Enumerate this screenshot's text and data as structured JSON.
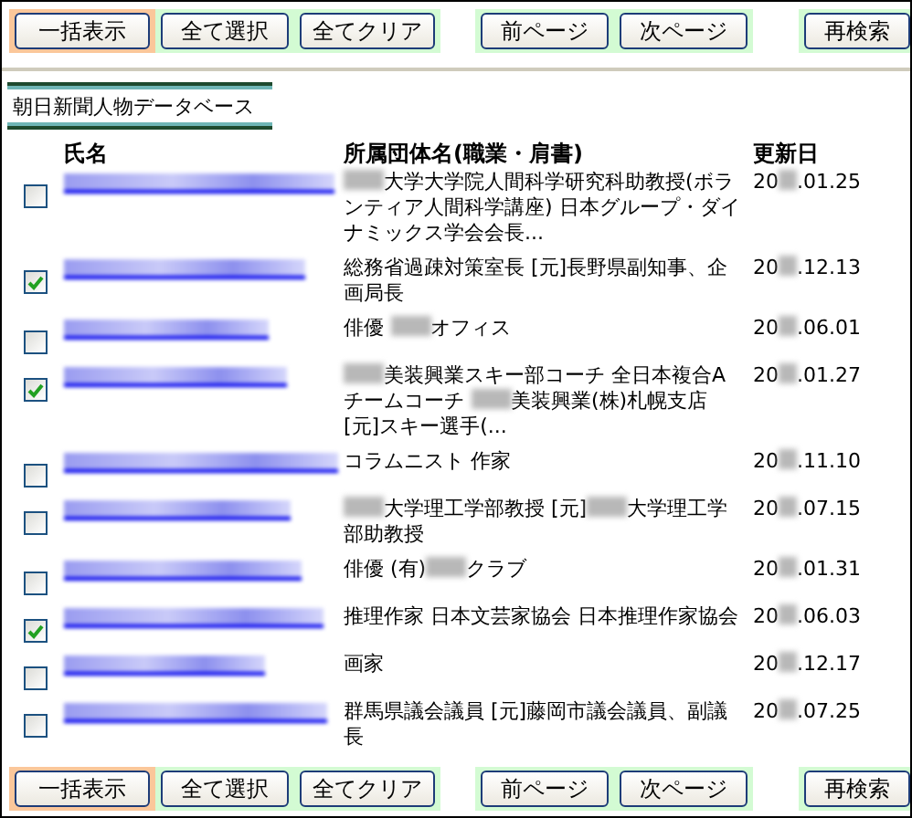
{
  "toolbar_top": [
    {
      "kind": "bulk",
      "label": "一括表示"
    },
    {
      "kind": "select",
      "label": "全て選択"
    },
    {
      "kind": "select",
      "label": "全てクリア"
    },
    {
      "kind": "page",
      "label": "前ページ"
    },
    {
      "kind": "page",
      "label": "次ページ"
    },
    {
      "kind": "search",
      "label": "再検索"
    }
  ],
  "banner": "朝日新聞人物データベース",
  "columns": [
    "氏名",
    "所属団体名(職業・肩書)",
    "更新日"
  ],
  "rows": [
    {
      "checked": false,
      "affiliation": [
        {
          "kind": "blur"
        },
        {
          "kind": "text",
          "text": "大学大学院人間科学研究科助教授(ボランティア人間科学講座) 日本グループ・ダイナミックス学会会長..."
        }
      ],
      "date": [
        {
          "kind": "text",
          "text": "20"
        },
        {
          "kind": "blur"
        },
        {
          "kind": "text",
          "text": ".01.25"
        }
      ]
    },
    {
      "checked": true,
      "affiliation": [
        {
          "kind": "text",
          "text": "総務省過疎対策室長 [元]長野県副知事、企画局長"
        }
      ],
      "date": [
        {
          "kind": "text",
          "text": "20"
        },
        {
          "kind": "blur"
        },
        {
          "kind": "text",
          "text": ".12.13"
        }
      ]
    },
    {
      "checked": false,
      "affiliation": [
        {
          "kind": "text",
          "text": "俳優 "
        },
        {
          "kind": "blur"
        },
        {
          "kind": "text",
          "text": "オフィス"
        }
      ],
      "date": [
        {
          "kind": "text",
          "text": "20"
        },
        {
          "kind": "blur"
        },
        {
          "kind": "text",
          "text": ".06.01"
        }
      ]
    },
    {
      "checked": true,
      "affiliation": [
        {
          "kind": "blur"
        },
        {
          "kind": "text",
          "text": "美装興業スキー部コーチ 全日本複合Aチームコーチ "
        },
        {
          "kind": "blur"
        },
        {
          "kind": "text",
          "text": "美装興業(株)札幌支店 [元]スキー選手(..."
        }
      ],
      "date": [
        {
          "kind": "text",
          "text": "20"
        },
        {
          "kind": "blur"
        },
        {
          "kind": "text",
          "text": ".01.27"
        }
      ]
    },
    {
      "checked": false,
      "affiliation": [
        {
          "kind": "text",
          "text": "コラムニスト 作家"
        }
      ],
      "date": [
        {
          "kind": "text",
          "text": "20"
        },
        {
          "kind": "blur"
        },
        {
          "kind": "text",
          "text": ".11.10"
        }
      ]
    },
    {
      "checked": false,
      "affiliation": [
        {
          "kind": "blur"
        },
        {
          "kind": "text",
          "text": "大学理工学部教授 [元]"
        },
        {
          "kind": "blur"
        },
        {
          "kind": "text",
          "text": "大学理工学部助教授"
        }
      ],
      "date": [
        {
          "kind": "text",
          "text": "20"
        },
        {
          "kind": "blur"
        },
        {
          "kind": "text",
          "text": ".07.15"
        }
      ]
    },
    {
      "checked": false,
      "affiliation": [
        {
          "kind": "text",
          "text": "俳優 (有)"
        },
        {
          "kind": "blur"
        },
        {
          "kind": "text",
          "text": "クラブ"
        }
      ],
      "date": [
        {
          "kind": "text",
          "text": "20"
        },
        {
          "kind": "blur"
        },
        {
          "kind": "text",
          "text": ".01.31"
        }
      ]
    },
    {
      "checked": true,
      "affiliation": [
        {
          "kind": "text",
          "text": "推理作家 日本文芸家協会 日本推理作家協会"
        }
      ],
      "date": [
        {
          "kind": "text",
          "text": "20"
        },
        {
          "kind": "blur"
        },
        {
          "kind": "text",
          "text": ".06.03"
        }
      ]
    },
    {
      "checked": false,
      "affiliation": [
        {
          "kind": "text",
          "text": "画家"
        }
      ],
      "date": [
        {
          "kind": "text",
          "text": "20"
        },
        {
          "kind": "blur"
        },
        {
          "kind": "text",
          "text": ".12.17"
        }
      ]
    },
    {
      "checked": false,
      "affiliation": [
        {
          "kind": "text",
          "text": "群馬県議会議員 [元]藤岡市議会議員、副議長"
        }
      ],
      "date": [
        {
          "kind": "text",
          "text": "20"
        },
        {
          "kind": "blur"
        },
        {
          "kind": "text",
          "text": ".07.25"
        }
      ]
    }
  ],
  "toolbar_bottom": [
    {
      "kind": "bulk",
      "label": "一括表示"
    },
    {
      "kind": "select",
      "label": "全て選択"
    },
    {
      "kind": "select",
      "label": "全てクリア"
    },
    {
      "kind": "page",
      "label": "前ページ"
    },
    {
      "kind": "page",
      "label": "次ページ"
    },
    {
      "kind": "search",
      "label": "再検索"
    }
  ]
}
